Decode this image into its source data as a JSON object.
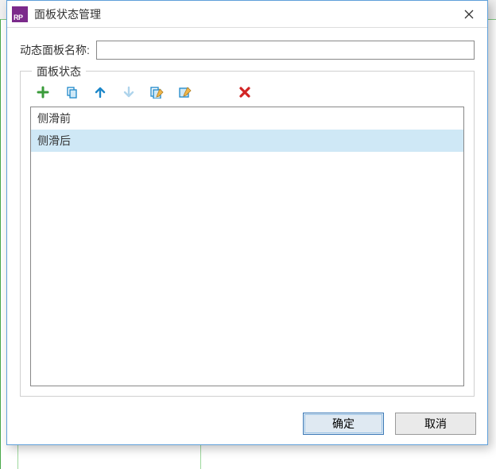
{
  "icons": {
    "app_badge": "RP"
  },
  "dialog": {
    "title": "面板状态管理",
    "name_label": "动态面板名称:",
    "name_value": ""
  },
  "fieldset": {
    "legend": "面板状态"
  },
  "toolbar": {
    "add": "add-icon",
    "duplicate": "duplicate-icon",
    "move_up": "arrow-up-icon",
    "move_down": "arrow-down-icon",
    "edit_all": "edit-all-icon",
    "edit": "edit-icon",
    "delete": "delete-icon"
  },
  "states": [
    {
      "label": "侧滑前",
      "selected": false
    },
    {
      "label": "侧滑后",
      "selected": true
    }
  ],
  "buttons": {
    "ok": "确定",
    "cancel": "取消"
  }
}
